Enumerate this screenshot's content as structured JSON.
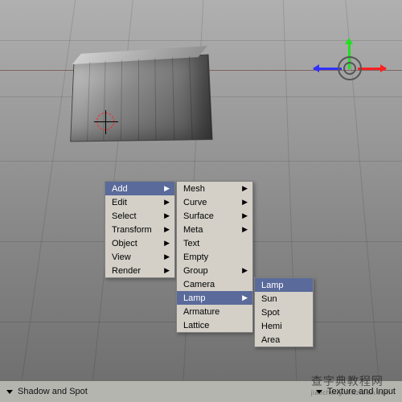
{
  "main_menu": {
    "items": [
      {
        "label": "Add",
        "has_sub": true,
        "highlight": true
      },
      {
        "label": "Edit",
        "has_sub": true,
        "highlight": false
      },
      {
        "label": "Select",
        "has_sub": true,
        "highlight": false
      },
      {
        "label": "Transform",
        "has_sub": true,
        "highlight": false
      },
      {
        "label": "Object",
        "has_sub": true,
        "highlight": false
      },
      {
        "label": "View",
        "has_sub": true,
        "highlight": false
      },
      {
        "label": "Render",
        "has_sub": true,
        "highlight": false
      }
    ]
  },
  "add_menu": {
    "items": [
      {
        "label": "Mesh",
        "has_sub": true,
        "highlight": false
      },
      {
        "label": "Curve",
        "has_sub": true,
        "highlight": false
      },
      {
        "label": "Surface",
        "has_sub": true,
        "highlight": false
      },
      {
        "label": "Meta",
        "has_sub": true,
        "highlight": false
      },
      {
        "label": "Text",
        "has_sub": false,
        "highlight": false
      },
      {
        "label": "Empty",
        "has_sub": false,
        "highlight": false
      },
      {
        "label": "Group",
        "has_sub": true,
        "highlight": false
      },
      {
        "label": "Camera",
        "has_sub": false,
        "highlight": false
      },
      {
        "label": "Lamp",
        "has_sub": true,
        "highlight": true
      },
      {
        "label": "Armature",
        "has_sub": false,
        "highlight": false
      },
      {
        "label": "Lattice",
        "has_sub": false,
        "highlight": false
      }
    ]
  },
  "lamp_menu": {
    "items": [
      {
        "label": "Lamp",
        "has_sub": false,
        "highlight": true
      },
      {
        "label": "Sun",
        "has_sub": false,
        "highlight": false
      },
      {
        "label": "Spot",
        "has_sub": false,
        "highlight": false
      },
      {
        "label": "Hemi",
        "has_sub": false,
        "highlight": false
      },
      {
        "label": "Area",
        "has_sub": false,
        "highlight": false
      }
    ]
  },
  "bottom_bar": {
    "panel1": "Shadow and Spot",
    "panel2": "Texture and Input"
  },
  "watermark": {
    "main": "查字典教程网",
    "sub": "jiaocheng.chazidian.com"
  },
  "gizmo": {
    "x_color": "#ff2020",
    "y_color": "#20e020",
    "z_color": "#3030ff"
  }
}
